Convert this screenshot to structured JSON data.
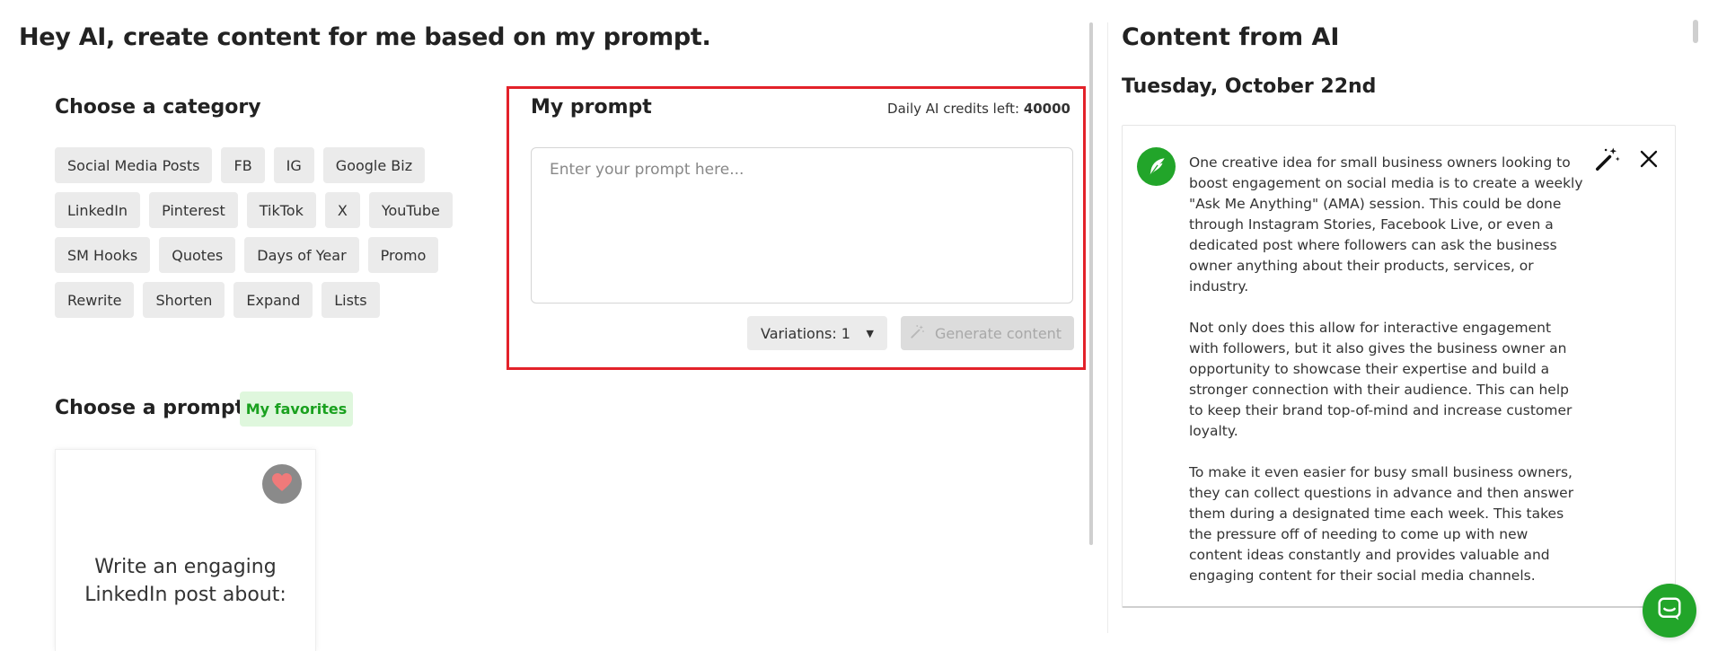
{
  "header": {
    "title": "Hey AI, create content for me based on my prompt."
  },
  "category": {
    "heading": "Choose a category",
    "rows": [
      [
        "Social Media Posts",
        "FB",
        "IG",
        "Google Biz"
      ],
      [
        "LinkedIn",
        "Pinterest",
        "TikTok",
        "X",
        "YouTube"
      ],
      [
        "SM Hooks",
        "Quotes",
        "Days of Year",
        "Promo"
      ],
      [
        "Rewrite",
        "Shorten",
        "Expand",
        "Lists"
      ]
    ]
  },
  "prompt_panel": {
    "title": "My prompt",
    "credits_label": "Daily AI credits left:",
    "credits_value": "40000",
    "input_placeholder": "Enter your prompt here...",
    "input_value": "",
    "variations_label": "Variations: 1",
    "generate_label": "Generate content"
  },
  "prompt_section": {
    "heading": "Choose a prompt",
    "favorites_label": "My favorites",
    "card_text": "Write an engaging LinkedIn post about:"
  },
  "ai_panel": {
    "title": "Content from AI",
    "date": "Tuesday, October 22nd",
    "paragraphs": [
      "One creative idea for small business owners looking to boost engagement on social media is to create a weekly \"Ask Me Anything\" (AMA) session. This could be done through Instagram Stories, Facebook Live, or even a dedicated post where followers can ask the business owner anything about their products, services, or industry.",
      "Not only does this allow for interactive engagement with followers, but it also gives the business owner an opportunity to showcase their expertise and build a stronger connection with their audience. This can help to keep their brand top-of-mind and increase customer loyalty.",
      "To make it even easier for busy small business owners, they can collect questions in advance and then answer them during a designated time each week. This takes the pressure off of needing to come up with new content ideas constantly and provides valuable and engaging content for their social media channels."
    ]
  },
  "icons": {
    "heart": "heart-icon",
    "avatar": "feather-icon",
    "magic": "magic-wand-icon",
    "close": "close-icon",
    "chat": "chat-icon",
    "caret": "caret-down-icon"
  },
  "colors": {
    "accent_green": "#22a52a",
    "highlight_red": "#e3222a",
    "favorites_bg": "#dff7dd",
    "heart": "#f07a7a"
  }
}
